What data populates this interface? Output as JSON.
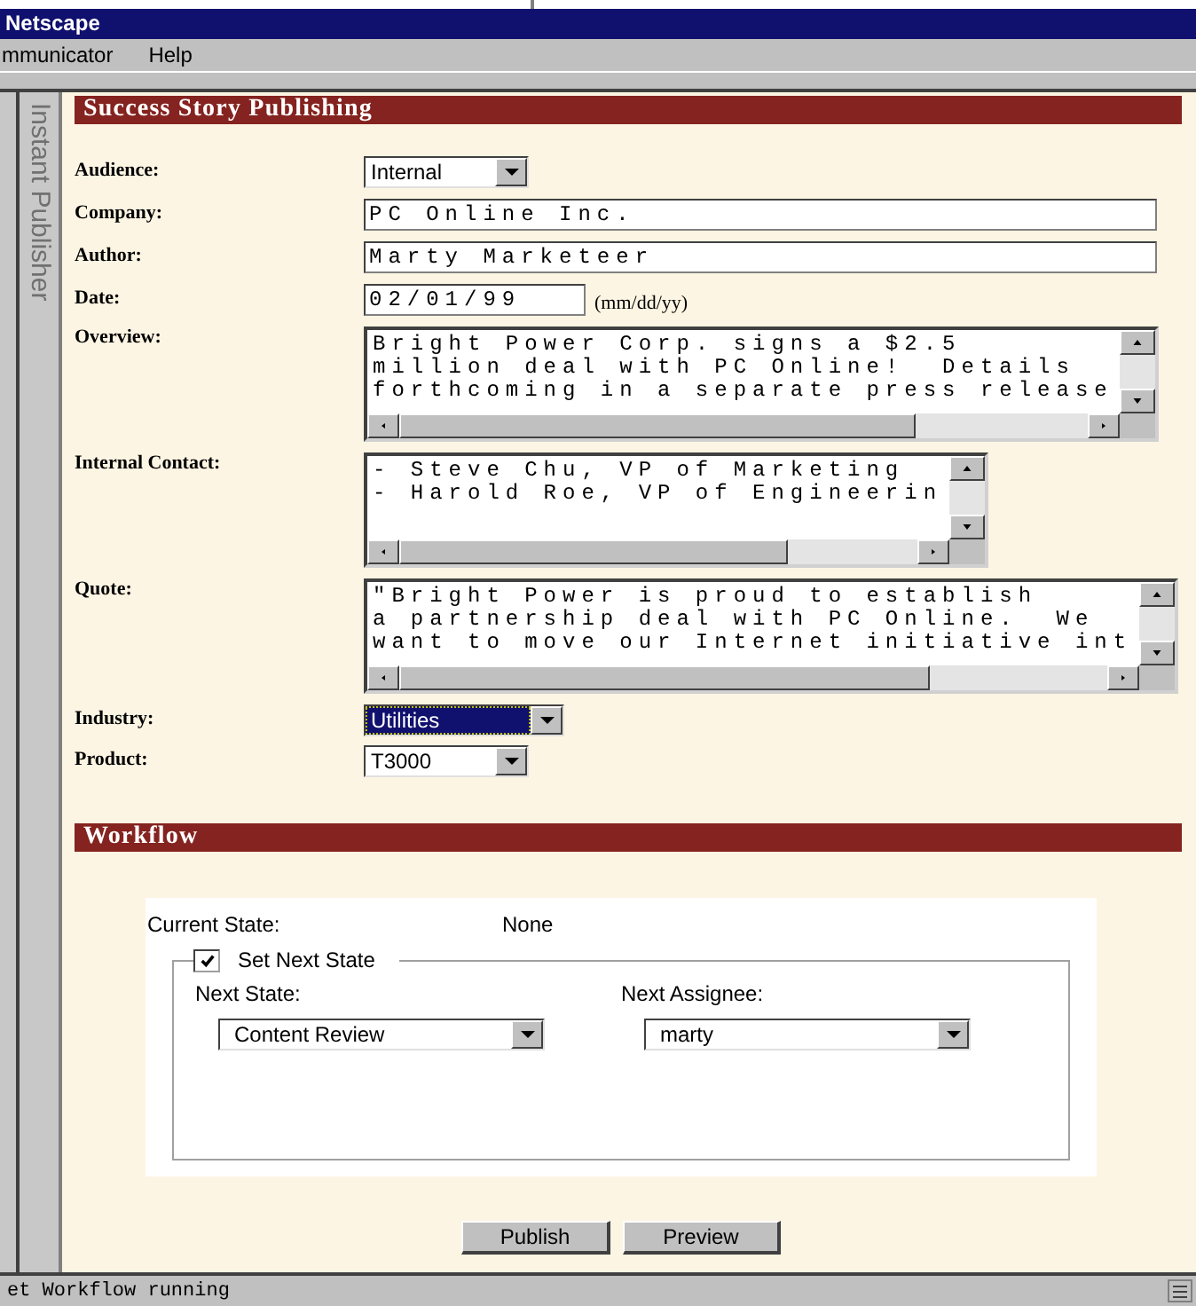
{
  "window": {
    "title": "Netscape"
  },
  "menu": [
    {
      "label": "mmunicator"
    },
    {
      "label": "Help"
    }
  ],
  "sidebar": {
    "title": "Instant Publisher"
  },
  "form": {
    "title": "Success Story Publishing",
    "fields": [
      {
        "label": "Audience:",
        "kind": "select",
        "value": "Internal",
        "focused": false
      },
      {
        "label": "Company:",
        "kind": "text",
        "value": "PC Online Inc."
      },
      {
        "label": "Author:",
        "kind": "text",
        "value": "Marty Marketeer"
      },
      {
        "label": "Date:",
        "kind": "date",
        "value": "02/01/99",
        "hint": "(mm/dd/yy)"
      },
      {
        "label": "Overview:",
        "kind": "textarea",
        "lines": [
          "Bright Power Corp. signs a $2.5",
          "million deal with PC Online!  Details",
          "forthcoming in a separate press release"
        ]
      },
      {
        "label": "Internal Contact:",
        "kind": "textarea",
        "lines": [
          "- Steve Chu, VP of Marketing",
          "- Harold Roe, VP of Engineerin"
        ]
      },
      {
        "label": "Quote:",
        "kind": "textarea",
        "lines": [
          "\"Bright Power is proud to establish",
          "a partnership deal with PC Online.  We",
          "want to move our Internet initiative int"
        ]
      },
      {
        "label": "Industry:",
        "kind": "select",
        "value": "Utilities",
        "focused": true
      },
      {
        "label": "Product:",
        "kind": "select",
        "value": "T3000",
        "focused": false
      }
    ]
  },
  "workflow": {
    "title": "Workflow",
    "current_state_label": "Current State:",
    "current_state": "None",
    "set_next": {
      "label": "Set Next State",
      "checked": true
    },
    "next_state": {
      "label": "Next State:",
      "value": "Content Review"
    },
    "next_assignee": {
      "label": "Next Assignee:",
      "value": "marty"
    }
  },
  "buttons": [
    {
      "label": "Publish"
    },
    {
      "label": "Preview"
    }
  ],
  "status_bar": {
    "text": "et Workflow running"
  }
}
